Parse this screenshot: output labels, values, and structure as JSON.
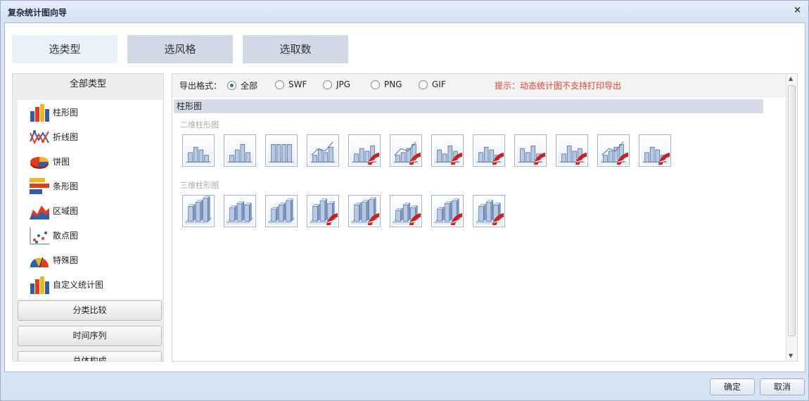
{
  "window": {
    "title": "复杂统计图向导",
    "close_icon": "×"
  },
  "steps": [
    "选类型",
    "选风格",
    "选取数"
  ],
  "left": {
    "header": "全部类型",
    "types": [
      "柱形图",
      "折线图",
      "饼图",
      "条形图",
      "区域图",
      "散点图",
      "特殊图",
      "自定义统计图"
    ],
    "categories": [
      "分类比较",
      "时间序列",
      "总体构成"
    ]
  },
  "export": {
    "label": "导出格式：",
    "options": [
      "全部",
      "SWF",
      "JPG",
      "PNG",
      "GIF"
    ],
    "selected": "全部",
    "hint": "提示：动态统计图不支持打印导出"
  },
  "section": {
    "title": "柱形图",
    "sub2d": "二维柱形图",
    "sub3d": "三维柱形图",
    "count_2d": 12,
    "count_3d": 8
  },
  "footer": {
    "ok": "确定",
    "cancel": "取消"
  },
  "colors": {
    "accent": "#3b6ea5",
    "hint": "#e0422b",
    "flash": "#cc1f1f"
  }
}
